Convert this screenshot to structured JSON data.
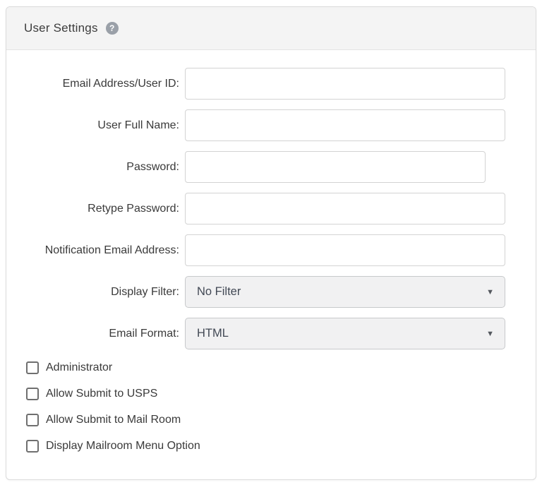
{
  "header": {
    "title": "User Settings",
    "help_icon": "?"
  },
  "form": {
    "fields": [
      {
        "label": "Email Address/User ID:",
        "value": "",
        "placeholder": ""
      },
      {
        "label": "User Full Name:",
        "value": "",
        "placeholder": ""
      },
      {
        "label": "Password:",
        "value": "",
        "placeholder": ""
      },
      {
        "label": "Retype Password:",
        "value": "",
        "placeholder": ""
      },
      {
        "label": "Notification Email Address:",
        "value": "",
        "placeholder": ""
      }
    ],
    "selects": [
      {
        "label": "Display Filter:",
        "value": "No Filter",
        "arrow": "▼"
      },
      {
        "label": "Email Format:",
        "value": "HTML",
        "arrow": "▼"
      }
    ]
  },
  "checkboxes": [
    {
      "label": "Administrator",
      "checked": false
    },
    {
      "label": "Allow Submit to USPS",
      "checked": false
    },
    {
      "label": "Allow Submit to Mail Room",
      "checked": false
    },
    {
      "label": "Display Mailroom Menu Option",
      "checked": false
    }
  ],
  "colors": {
    "header_bg": "#f4f4f4",
    "card_border": "#dbdbdb",
    "input_border": "#d3d3d3",
    "select_bg": "#f1f1f2",
    "select_text": "#414854",
    "label_text": "#3a3a3a",
    "help_icon_bg": "#9aa0a8"
  }
}
